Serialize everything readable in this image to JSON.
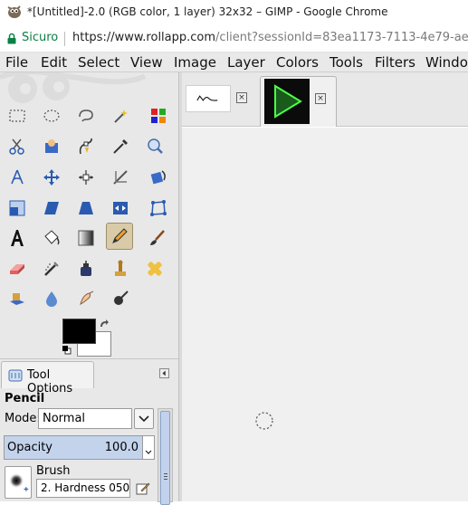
{
  "window": {
    "title": "*[Untitled]-2.0 (RGB color, 1 layer) 32x32 – GIMP - Google Chrome",
    "logo_icon": "gimp-icon"
  },
  "address_bar": {
    "secure_label": "Sicuro",
    "url_scheme_host": "https://www.rollapp.com",
    "url_rest": "/client?sessionId=83ea1173-7113-4e79-ae74-",
    "secure_color": "#0b8043"
  },
  "menu": [
    {
      "label": "File"
    },
    {
      "label": "Edit"
    },
    {
      "label": "Select"
    },
    {
      "label": "View"
    },
    {
      "label": "Image"
    },
    {
      "label": "Layer"
    },
    {
      "label": "Colors"
    },
    {
      "label": "Tools"
    },
    {
      "label": "Filters"
    },
    {
      "label": "Window"
    }
  ],
  "toolbox": {
    "tools": [
      "rect-select-icon",
      "ellipse-select-icon",
      "free-select-icon",
      "fuzzy-select-icon",
      "select-by-color-icon",
      "scissors-select-icon",
      "foreground-select-icon",
      "paths-icon",
      "color-picker-icon",
      "zoom-icon",
      "measure-icon",
      "move-icon",
      "align-icon",
      "crop-icon",
      "rotate-icon",
      "scale-icon",
      "shear-icon",
      "perspective-icon",
      "flip-icon",
      "cage-transform-icon",
      "text-icon",
      "bucket-fill-icon",
      "blend-icon",
      "pencil-icon",
      "paintbrush-icon",
      "eraser-icon",
      "airbrush-icon",
      "ink-icon",
      "clone-icon",
      "heal-icon",
      "perspective-clone-icon",
      "blur-sharpen-icon",
      "smudge-icon",
      "dodge-burn-icon"
    ],
    "active_tool": "pencil-icon",
    "foreground_color": "#000000",
    "background_color": "#ffffff"
  },
  "tool_options": {
    "tab_label": "Tool Options",
    "tool_name": "Pencil",
    "mode_label": "Mode:",
    "mode_value": "Normal",
    "opacity_label": "Opacity",
    "opacity_value": "100.0",
    "brush_label": "Brush",
    "brush_value": "2. Hardness 050"
  },
  "image_tabs": [
    {
      "name": "image-1",
      "close_label": "×"
    },
    {
      "name": "image-2",
      "close_label": "×"
    }
  ]
}
